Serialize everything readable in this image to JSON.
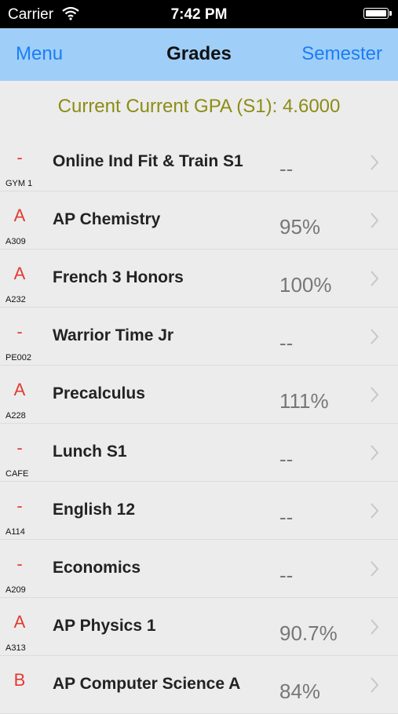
{
  "status_bar": {
    "carrier": "Carrier",
    "time": "7:42 PM"
  },
  "nav": {
    "left": "Menu",
    "title": "Grades",
    "right": "Semester"
  },
  "gpa_text": "Current Current GPA (S1): 4.6000",
  "courses": [
    {
      "grade": "-",
      "room": "GYM 1",
      "name": "Online Ind Fit & Train S1",
      "percent": "--"
    },
    {
      "grade": "A",
      "room": "A309",
      "name": "AP Chemistry",
      "percent": "95%"
    },
    {
      "grade": "A",
      "room": "A232",
      "name": "French 3 Honors",
      "percent": "100%"
    },
    {
      "grade": "-",
      "room": "PE002",
      "name": "Warrior Time Jr",
      "percent": "--"
    },
    {
      "grade": "A",
      "room": "A228",
      "name": "Precalculus",
      "percent": "111%"
    },
    {
      "grade": "-",
      "room": "CAFE",
      "name": "Lunch S1",
      "percent": "--"
    },
    {
      "grade": "-",
      "room": "A114",
      "name": "English 12",
      "percent": "--"
    },
    {
      "grade": "-",
      "room": "A209",
      "name": "Economics",
      "percent": "--"
    },
    {
      "grade": "A",
      "room": "A313",
      "name": "AP Physics 1",
      "percent": "90.7%"
    },
    {
      "grade": "B",
      "room": "",
      "name": "AP Computer Science A",
      "percent": "84%"
    }
  ],
  "colors": {
    "nav_bg": "#9fcef8",
    "nav_link": "#1a7ef5",
    "gpa_text": "#8c8c16",
    "grade_text": "#e23b30"
  },
  "icons": {
    "wifi": "wifi-icon",
    "battery": "battery-icon",
    "row_disclosure": "chevron-right-icon"
  }
}
